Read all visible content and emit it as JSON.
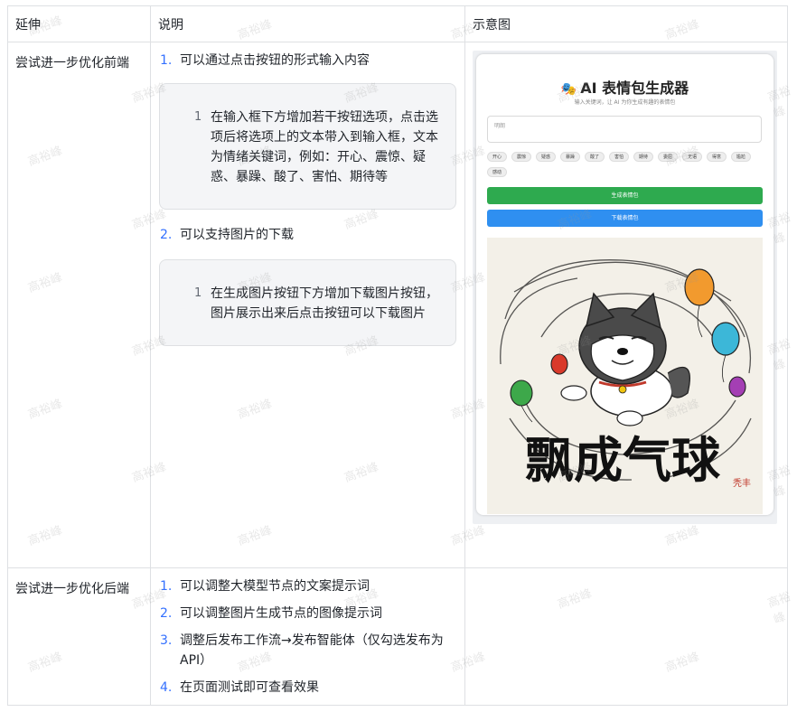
{
  "table": {
    "headers": [
      "延伸",
      "说明",
      "示意图"
    ],
    "row1": {
      "label": "尝试进一步优化前端",
      "items": [
        {
          "num": "1.",
          "text": "可以通过点击按钮的形式输入内容",
          "callout_num": "1",
          "callout_lines": [
            "在输入框下方增加若干按钮选项，点击选",
            "项后将选项上的文本带入到输入框，文本",
            "为情绪关键词，例如：开心、震惊、疑",
            "惑、暴躁、酸了、害怕、期待等"
          ]
        },
        {
          "num": "2.",
          "text": "可以支持图片的下载",
          "callout_num": "1",
          "callout_lines": [
            "在生成图片按钮下方增加下载图片按钮，",
            "图片展示出来后点击按钮可以下载图片"
          ]
        }
      ]
    },
    "row2": {
      "label": "尝试进一步优化后端",
      "items": [
        {
          "num": "1.",
          "lines": [
            "可以调整大模型节点的文案提示词"
          ]
        },
        {
          "num": "2.",
          "lines": [
            "可以调整图片生成节点的图像提示词"
          ]
        },
        {
          "num": "3.",
          "lines": [
            "调整后发布工作流→发布智能体（仅勾选发布为",
            "API）"
          ]
        },
        {
          "num": "4.",
          "lines": [
            "在页面测试即可查看效果"
          ]
        }
      ]
    }
  },
  "mockup": {
    "title": "AI 表情包生成器",
    "icon": "theater-masks-icon",
    "subtitle": "输入关键词，让 AI 为你生成有趣的表情包",
    "input_placeholder": "明朗",
    "chips_row1": [
      "开心",
      "震惊",
      "疑惑",
      "暴躁",
      "酸了",
      "害怕",
      "期待",
      "委屈",
      "无语",
      "得意",
      "尴尬"
    ],
    "chips_row2": [
      "感动"
    ],
    "generate_button": "生成表情包",
    "download_button": "下载表情包",
    "image_caption": "飘成气球",
    "seal_text": "秃丰"
  },
  "watermark": "高裕峰",
  "colors": {
    "border": "#dee0e3",
    "accent": "#3370ff",
    "callout_bg": "#f4f5f7",
    "green": "#2eaa4f",
    "blue": "#2f8ff0"
  }
}
